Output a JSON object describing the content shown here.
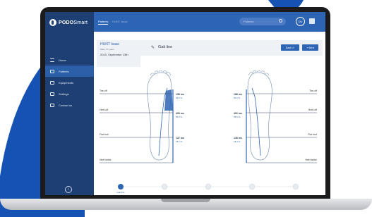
{
  "app": {
    "brand_bold": "PODO",
    "brand_light": "Smart"
  },
  "sidebar": {
    "items": [
      {
        "label": "Home",
        "active": false
      },
      {
        "label": "Patients",
        "active": true
      },
      {
        "label": "Equipments",
        "active": false
      },
      {
        "label": "Settings",
        "active": false
      },
      {
        "label": "Contact us",
        "active": false
      }
    ]
  },
  "topbar": {
    "tabs": [
      "Patients",
      "HUNT Isaac"
    ],
    "search_placeholder": "Patients",
    "avatar_initials": "DU"
  },
  "patient": {
    "name": "HUNT Isaac",
    "meta": "Male, 37 years",
    "date": "2019, September 13th"
  },
  "view": {
    "title": "Gait line",
    "back_label": "Back",
    "next_label": "Next"
  },
  "left_foot": {
    "labels": [
      "Toe-off",
      "Heel-off",
      "Flat foot",
      "Heel strike"
    ],
    "values": [
      {
        "ms": "196 ms",
        "pct": "26.6 %"
      },
      {
        "ms": "409 ms",
        "pct": "55.3 %"
      },
      {
        "ms": "137 ms",
        "pct": "18.1 %"
      }
    ]
  },
  "right_foot": {
    "labels": [
      "Toe-off",
      "Heel-off",
      "Flat foot",
      "Heel strike"
    ],
    "values": [
      {
        "ms": "186 ms",
        "pct": "26.0 %"
      },
      {
        "ms": "402 ms",
        "pct": "55.6 %"
      },
      {
        "ms": "136 ms",
        "pct": "18.4 %"
      }
    ]
  },
  "steps": {
    "current_index": 0,
    "labels": [
      "Gait line",
      "",
      "",
      "",
      ""
    ]
  },
  "colors": {
    "primary": "#2d64b3",
    "sidebar": "#1d3f73",
    "background_blob": "#1552b3"
  }
}
